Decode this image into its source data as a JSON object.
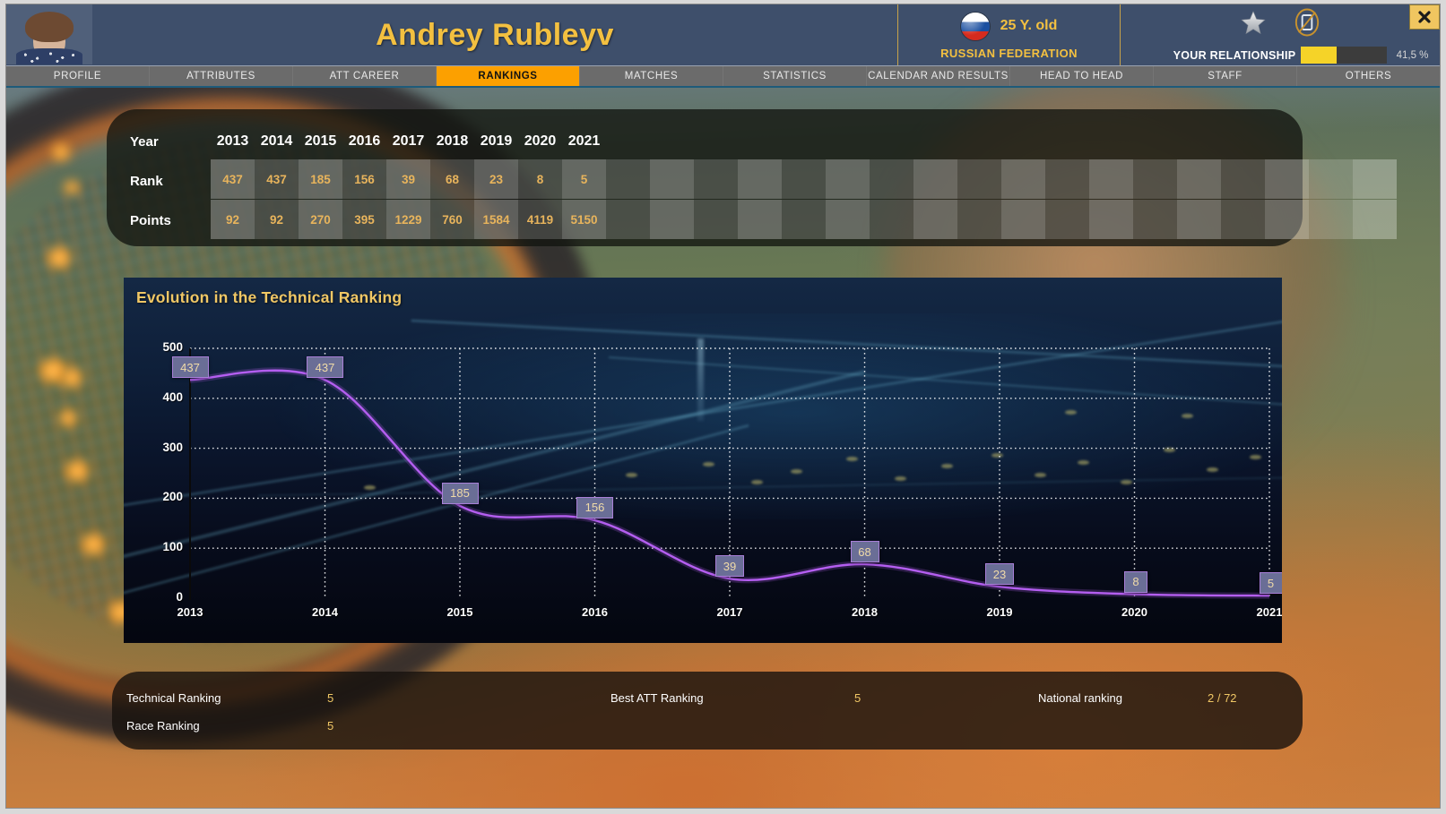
{
  "header": {
    "player_name": "Andrey Rubleyv",
    "age": "25 Y. old",
    "nation": "RUSSIAN FEDERATION",
    "flag_icon": "russia-flag-icon",
    "star_icon": "star-icon",
    "no_phone_icon": "no-phone-icon",
    "relationship_label": "YOUR RELATIONSHIP",
    "relationship_pct_text": "41,5 %",
    "relationship_pct_value": 41.5,
    "close_icon": "close-icon"
  },
  "tabs": [
    {
      "label": "PROFILE",
      "active": false
    },
    {
      "label": "ATTRIBUTES",
      "active": false
    },
    {
      "label": "ATT CAREER",
      "active": false
    },
    {
      "label": "RANKINGS",
      "active": true
    },
    {
      "label": "MATCHES",
      "active": false
    },
    {
      "label": "STATISTICS",
      "active": false
    },
    {
      "label": "CALENDAR AND RESULTS",
      "active": false
    },
    {
      "label": "HEAD TO HEAD",
      "active": false
    },
    {
      "label": "STAFF",
      "active": false
    },
    {
      "label": "OTHERS",
      "active": false
    }
  ],
  "rankings_table": {
    "row_labels": {
      "year": "Year",
      "rank": "Rank",
      "points": "Points"
    },
    "years": [
      "2013",
      "2014",
      "2015",
      "2016",
      "2017",
      "2018",
      "2019",
      "2020",
      "2021"
    ],
    "ranks": [
      "437",
      "437",
      "185",
      "156",
      "39",
      "68",
      "23",
      "8",
      "5"
    ],
    "points": [
      "92",
      "92",
      "270",
      "395",
      "1229",
      "760",
      "1584",
      "4119",
      "5150"
    ],
    "empty_columns": 18
  },
  "chart_data": {
    "type": "line",
    "title": "Evolution in the Technical Ranking",
    "xlabel": "",
    "ylabel": "",
    "x": [
      2013,
      2014,
      2015,
      2016,
      2017,
      2018,
      2019,
      2020,
      2021
    ],
    "categories": [
      "2013",
      "2014",
      "2015",
      "2016",
      "2017",
      "2018",
      "2019",
      "2020",
      "2021"
    ],
    "values": [
      437,
      437,
      185,
      156,
      39,
      68,
      23,
      8,
      5
    ],
    "point_labels": [
      "437",
      "437",
      "185",
      "156",
      "39",
      "68",
      "23",
      "8",
      "5"
    ],
    "ylim": [
      0,
      500
    ],
    "yticks": [
      "500",
      "400",
      "300",
      "200",
      "100",
      "0"
    ],
    "ytick_values": [
      500,
      400,
      300,
      200,
      100,
      0
    ],
    "grid": true,
    "legend": "none",
    "line_color": "#b45ef0",
    "label_bg_color": "#6a6e96",
    "label_text_color": "#f0dba8"
  },
  "bottom_stats": [
    {
      "label": "Technical Ranking",
      "value": "5"
    },
    {
      "label": "Race Ranking",
      "value": "5"
    },
    {
      "label": "Best ATT Ranking",
      "value": "5"
    },
    {
      "label": "National ranking",
      "value": "2  / 72"
    }
  ],
  "colors": {
    "accent_gold": "#f3c040",
    "tab_active": "#fca000",
    "header_bg": "#3e4f6b",
    "chart_line": "#b45ef0"
  }
}
